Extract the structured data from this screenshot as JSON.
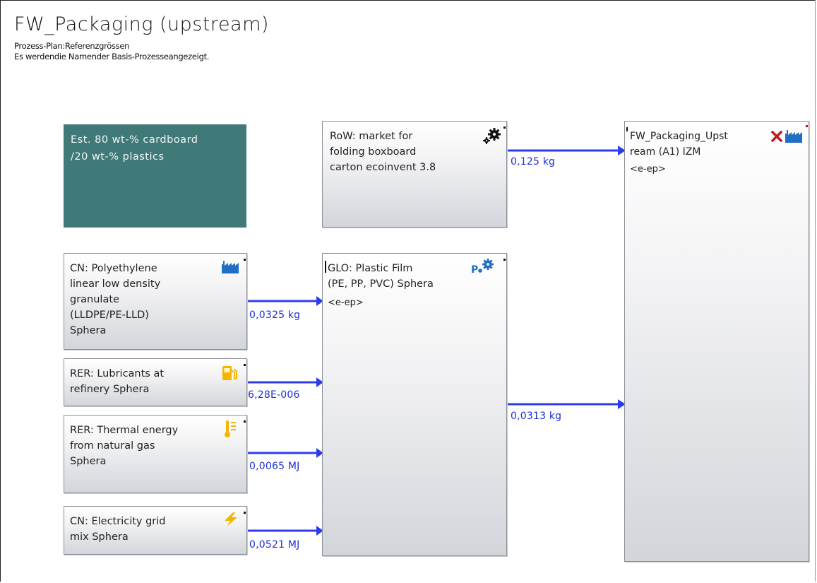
{
  "title": "FW_Packaging (upstream)",
  "subtitle1": "Prozess-Plan:Referenzgrössen",
  "subtitle2": "Es werdendie Namender Basis-Prozesseangezeigt.",
  "note": "Est. 80 wt-% cardboard\n/20 wt-% plastics",
  "processes": {
    "market_boxboard": {
      "label": "RoW: market for\nfolding boxboard\ncarton ecoinvent 3.8",
      "icon": "gears-icon"
    },
    "fw_packaging": {
      "label": "FW_Packaging_Upst\nream (A1) IZM",
      "tag": "<e-ep>",
      "icon": "factory-icon",
      "status_icon": "x-icon"
    },
    "plastic_film": {
      "label": "GLO: Plastic Film\n(PE, PP, PVC) Sphera",
      "tag": "<e-ep>",
      "icon": "p-gear-icon"
    },
    "polyethylene": {
      "label": "CN: Polyethylene\nlinear low density\ngranulate\n(LLDPE/PE-LLD)\nSphera",
      "icon": "factory-icon"
    },
    "lubricants": {
      "label": "RER: Lubricants at\nrefinery Sphera",
      "icon": "fuel-pump-icon"
    },
    "thermal": {
      "label": "RER: Thermal energy\nfrom natural gas\nSphera",
      "icon": "thermometer-icon"
    },
    "electricity": {
      "label": "CN: Electricity grid\nmix Sphera",
      "icon": "lightning-icon"
    }
  },
  "flows": {
    "boxboard_to_fw": "0,125 kg",
    "pe_to_film": "0,0325 kg",
    "lub_to_film": "6,28E-006",
    "thermal_to_film": "0,0065 MJ",
    "elec_to_film": "0,0521 MJ",
    "film_to_fw": "0,0313 kg"
  },
  "colors": {
    "flow": "#2b3cf0",
    "note_bg": "#3f7a78",
    "x_mark": "#c4161c",
    "icon_blue": "#1f6fc4",
    "icon_yellow": "#f5b400"
  }
}
